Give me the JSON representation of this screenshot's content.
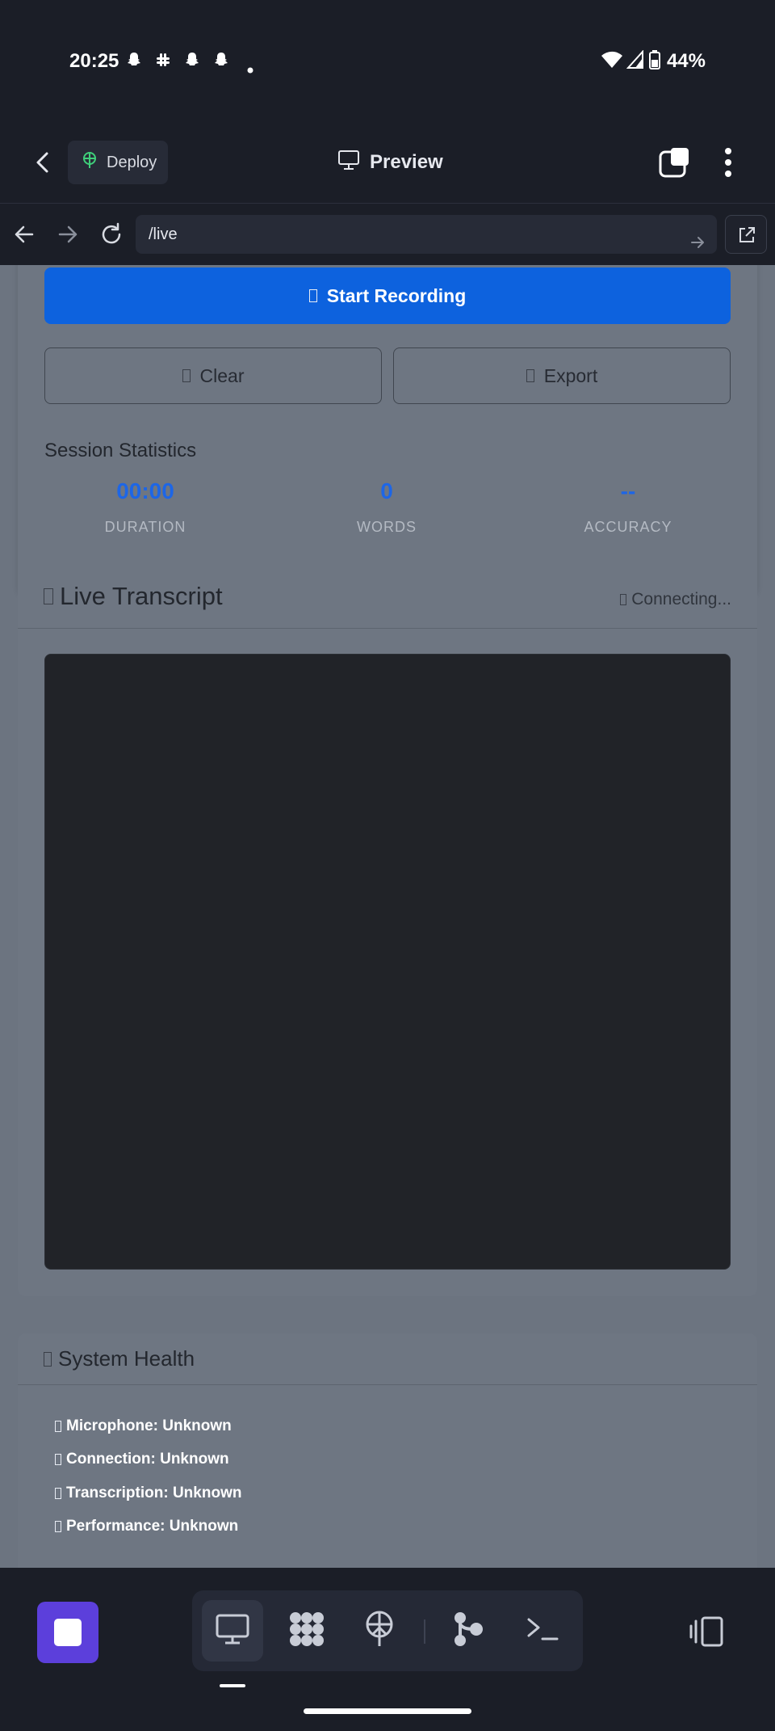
{
  "status_bar": {
    "time": "20:25",
    "battery": "44%",
    "notifications": [
      "snapchat-icon",
      "slack-icon",
      "snapchat-icon",
      "snapchat-icon",
      "dot-icon"
    ]
  },
  "toolbar": {
    "deploy_label": "Deploy",
    "preview_label": "Preview"
  },
  "browser": {
    "url": "/live"
  },
  "controls": {
    "start_recording_label": "Start Recording",
    "clear_label": "Clear",
    "export_label": "Export"
  },
  "session_stats": {
    "title": "Session Statistics",
    "duration_value": "00:00",
    "duration_label": "DURATION",
    "words_value": "0",
    "words_label": "WORDS",
    "accuracy_value": "--",
    "accuracy_label": "ACCURACY"
  },
  "transcript": {
    "title": "Live Transcript",
    "status": "Connecting..."
  },
  "system_health": {
    "title": "System Health",
    "items": [
      "Microphone: Unknown",
      "Connection: Unknown",
      "Transcription: Unknown",
      "Performance: Unknown"
    ]
  },
  "colors": {
    "primary": "#0d62de",
    "stat_value": "#1d66e6",
    "stop_button": "#5c3fdb",
    "background": "#1b1e27",
    "page_background": "#6c7480",
    "transcript_box": "#212328"
  }
}
